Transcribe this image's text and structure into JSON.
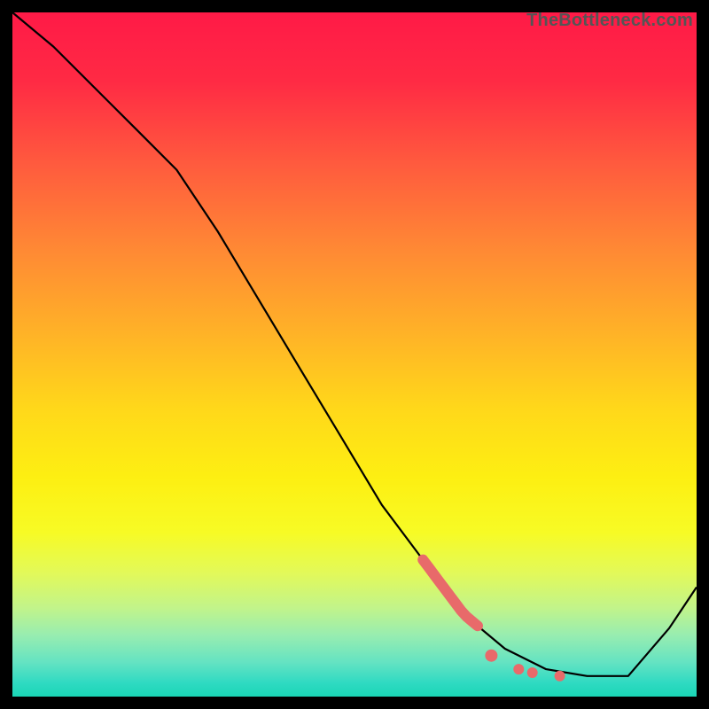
{
  "watermark": "TheBottleneck.com",
  "chart_data": {
    "type": "line",
    "title": "",
    "xlabel": "",
    "ylabel": "",
    "xlim": [
      0,
      100
    ],
    "ylim": [
      0,
      100
    ],
    "series": [
      {
        "name": "curve",
        "x": [
          0,
          6,
          12,
          18,
          24,
          30,
          36,
          42,
          48,
          54,
          60,
          66,
          72,
          78,
          84,
          90,
          96,
          100
        ],
        "y": [
          100,
          95,
          89,
          83,
          77,
          68,
          58,
          48,
          38,
          28,
          20,
          12,
          7,
          4,
          3,
          3,
          10,
          16
        ]
      }
    ],
    "highlights": {
      "thick_segment": {
        "x_start": 60,
        "x_end": 68
      },
      "dots": [
        {
          "x": 70,
          "y": 6
        },
        {
          "x": 74,
          "y": 4
        },
        {
          "x": 76,
          "y": 3.5
        },
        {
          "x": 80,
          "y": 3
        }
      ]
    },
    "colors": {
      "curve": "#000000",
      "highlight": "#e86a6a",
      "background_top": "#ff1a47",
      "background_bottom": "#1ad6b5"
    }
  }
}
